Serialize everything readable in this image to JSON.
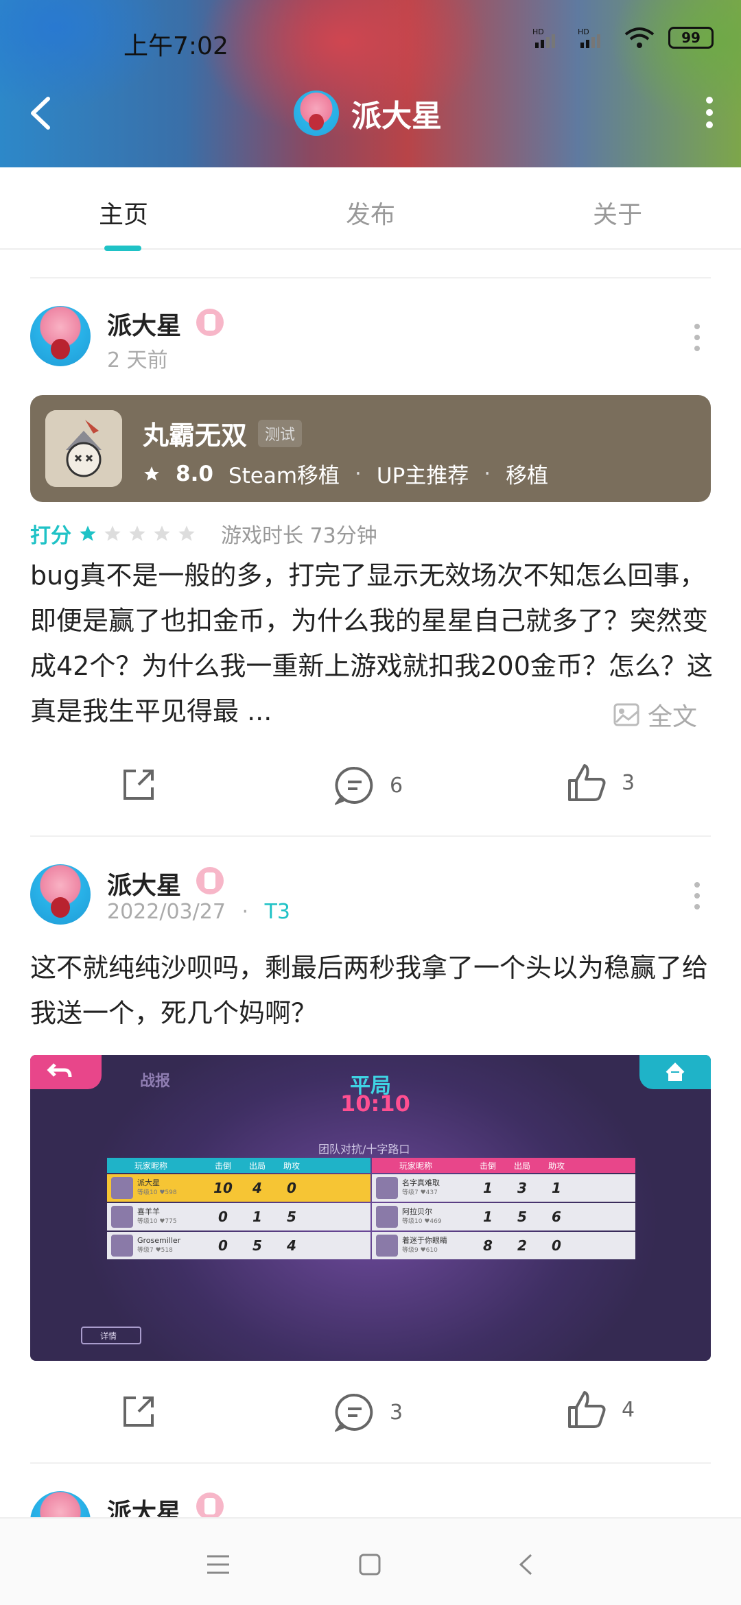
{
  "status_bar": {
    "time": "上午7:02",
    "signal_1": "HD",
    "signal_2": "HD",
    "battery": "99"
  },
  "header": {
    "title": "派大星"
  },
  "tabs": [
    {
      "label": "主页",
      "active": true
    },
    {
      "label": "发布",
      "active": false
    },
    {
      "label": "关于",
      "active": false
    }
  ],
  "colors": {
    "accent": "#1fc2c6",
    "game_card": "#7a6e5c",
    "badge": "#f7b6c8"
  },
  "posts": [
    {
      "user": "派大星",
      "time": "2 天前",
      "game": {
        "title": "丸霸无双",
        "tag": "测试",
        "rating": "8.0",
        "labels": [
          "Steam移植",
          "UP主推荐",
          "移植"
        ]
      },
      "score_label": "打分",
      "stars": 1,
      "max_stars": 5,
      "playtime": "游戏时长 73分钟",
      "text": "bug真不是一般的多，打完了显示无效场次不知怎么回事，即便是赢了也扣金币，为什么我的星星自己就多了？突然变成42个？为什么我一重新上游戏就扣我200金币？怎么？这真是我生平见得最 ...",
      "fulltext_label": "全文",
      "comments": "6",
      "likes": "3"
    },
    {
      "user": "派大星",
      "time": "2022/03/27",
      "tag": "T3",
      "text": "这不就纯纯沙呗吗，剩最后两秒我拿了一个头以为稳赢了给我送一个，死几个妈啊？",
      "screenshot": {
        "label": "战报",
        "result": "平局",
        "score": "10:10",
        "mode": "团队对抗/十字路口",
        "detail": "详情",
        "headers": [
          "玩家昵称",
          "击倒",
          "出局",
          "助攻"
        ],
        "team_left": [
          {
            "name": "派大星",
            "level": "等级10 ♥598",
            "k": "10",
            "d": "4",
            "a": "0"
          },
          {
            "name": "喜羊羊",
            "level": "等级10 ♥775",
            "k": "0",
            "d": "1",
            "a": "5"
          },
          {
            "name": "Grosemiller",
            "level": "等级7 ♥518",
            "k": "0",
            "d": "5",
            "a": "4"
          }
        ],
        "team_right": [
          {
            "name": "名字真难取",
            "level": "等级7 ♥437",
            "k": "1",
            "d": "3",
            "a": "1"
          },
          {
            "name": "阿拉贝尔",
            "level": "等级10 ♥469",
            "k": "1",
            "d": "5",
            "a": "6"
          },
          {
            "name": "着迷于你眼睛",
            "level": "等级9 ♥610",
            "k": "8",
            "d": "2",
            "a": "0"
          }
        ]
      },
      "comments": "3",
      "likes": "4"
    },
    {
      "user": "派大星"
    }
  ]
}
